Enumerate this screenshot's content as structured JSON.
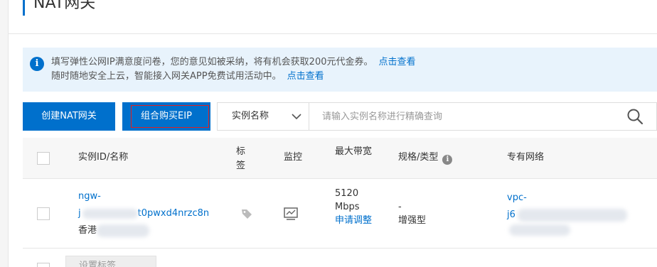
{
  "page": {
    "title": "NAT网关"
  },
  "notice": {
    "line1_text": "填写弹性公网IP满意度问卷，您的意见如被采纳，将有机会获取200元代金券。",
    "line1_link": "点击查看",
    "line2_text": "随时随地安全上云，智能接入网关APP免费试用活动中。",
    "line2_link": "点击查看"
  },
  "toolbar": {
    "create_label": "创建NAT网关",
    "combo_label": "组合购买EIP",
    "search_field_selected": "实例名称",
    "search_placeholder": "请输入实例名称进行精确查询"
  },
  "table": {
    "headers": {
      "id_name": "实例ID/名称",
      "tag": "标签",
      "monitor": "监控",
      "bandwidth": "最大带宽",
      "spec": "规格/类型",
      "vpc": "专有网络"
    },
    "rows": [
      {
        "id_line1": "ngw-",
        "id_line2": "j",
        "id_line2_tail": "t0pwxd4nrzc8n",
        "region": "香港",
        "bandwidth_value": "5120",
        "bandwidth_unit": "Mbps",
        "bandwidth_action": "申请调整",
        "spec_line1": "-",
        "spec_line2": "增强型",
        "vpc_line1": "vpc-",
        "vpc_line2": "j6"
      }
    ]
  },
  "footer": {
    "button_label": "设置标签"
  },
  "colors": {
    "primary": "#0070cc",
    "notice_bg": "#e8f3fc",
    "highlight_outline": "#e02020"
  },
  "icons": [
    "info-icon",
    "chevron-down-icon",
    "search-icon",
    "tag-icon",
    "monitor-icon",
    "info-circle-icon"
  ]
}
